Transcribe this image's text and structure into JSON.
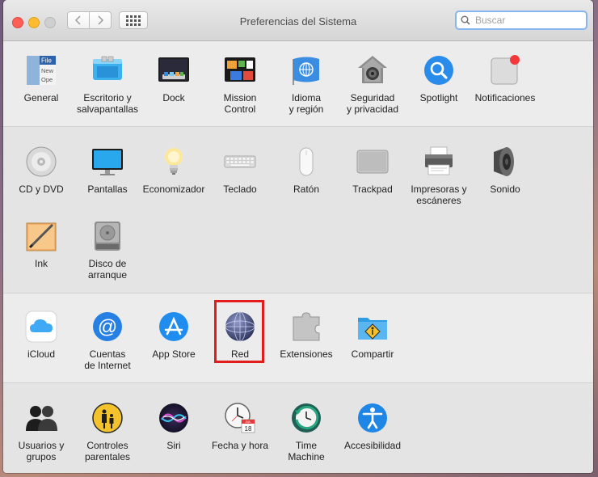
{
  "window": {
    "title": "Preferencias del Sistema",
    "search_placeholder": "Buscar"
  },
  "sections": {
    "personal": [
      {
        "label": "General",
        "icon": "general-icon"
      },
      {
        "label": "Escritorio y\nsalvapantallas",
        "icon": "desktop-screensaver-icon"
      },
      {
        "label": "Dock",
        "icon": "dock-icon"
      },
      {
        "label": "Mission\nControl",
        "icon": "mission-control-icon"
      },
      {
        "label": "Idioma\ny región",
        "icon": "language-region-icon"
      },
      {
        "label": "Seguridad\ny privacidad",
        "icon": "security-privacy-icon"
      },
      {
        "label": "Spotlight",
        "icon": "spotlight-icon"
      },
      {
        "label": "Notificaciones",
        "icon": "notifications-icon"
      }
    ],
    "hardware": [
      {
        "label": "CD y DVD",
        "icon": "cd-dvd-icon"
      },
      {
        "label": "Pantallas",
        "icon": "displays-icon"
      },
      {
        "label": "Economizador",
        "icon": "energy-saver-icon"
      },
      {
        "label": "Teclado",
        "icon": "keyboard-icon"
      },
      {
        "label": "Ratón",
        "icon": "mouse-icon"
      },
      {
        "label": "Trackpad",
        "icon": "trackpad-icon"
      },
      {
        "label": "Impresoras y\nescáneres",
        "icon": "printers-scanners-icon"
      },
      {
        "label": "Sonido",
        "icon": "sound-icon"
      },
      {
        "label": "Ink",
        "icon": "ink-icon"
      },
      {
        "label": "Disco de\narranque",
        "icon": "startup-disk-icon"
      }
    ],
    "internet": [
      {
        "label": "iCloud",
        "icon": "icloud-icon"
      },
      {
        "label": "Cuentas\nde Internet",
        "icon": "internet-accounts-icon"
      },
      {
        "label": "App Store",
        "icon": "app-store-icon"
      },
      {
        "label": "Red",
        "icon": "network-icon"
      },
      {
        "label": "Extensiones",
        "icon": "extensions-icon"
      },
      {
        "label": "Compartir",
        "icon": "sharing-icon"
      }
    ],
    "system": [
      {
        "label": "Usuarios y\ngrupos",
        "icon": "users-groups-icon"
      },
      {
        "label": "Controles\nparentales",
        "icon": "parental-controls-icon"
      },
      {
        "label": "Siri",
        "icon": "siri-icon"
      },
      {
        "label": "Fecha y hora",
        "icon": "date-time-icon"
      },
      {
        "label": "Time\nMachine",
        "icon": "time-machine-icon"
      },
      {
        "label": "Accesibilidad",
        "icon": "accessibility-icon"
      }
    ]
  },
  "icon_text": {
    "general_file": "File",
    "general_new": "New",
    "general_open": "Ope",
    "calendar_month": "JUL",
    "calendar_day": "18"
  },
  "highlight_color": "#e21b1b"
}
